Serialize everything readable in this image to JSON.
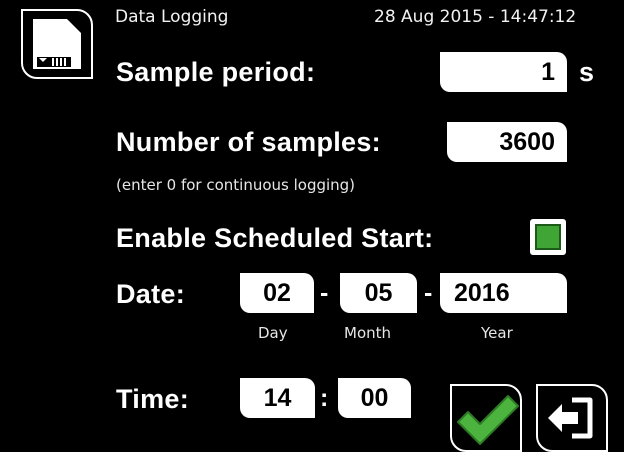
{
  "header": {
    "title": "Data Logging",
    "datetime": "28 Aug 2015 - 14:47:12"
  },
  "sample_period": {
    "label": "Sample period:",
    "value": "1",
    "unit": "s"
  },
  "number_of_samples": {
    "label": "Number of samples:",
    "value": "3600",
    "hint": "(enter 0 for continuous logging)"
  },
  "scheduled_start": {
    "label": "Enable Scheduled Start:",
    "checked": true
  },
  "date": {
    "label": "Date:",
    "day": "02",
    "month": "05",
    "year": "2016",
    "separator": "-",
    "day_caption": "Day",
    "month_caption": "Month",
    "year_caption": "Year"
  },
  "time": {
    "label": "Time:",
    "hour": "14",
    "minute": "00",
    "separator": ":"
  },
  "icons": {
    "storage": "sd-card-icon",
    "confirm": "checkmark-icon",
    "exit": "exit-arrow-icon"
  },
  "colors": {
    "background": "#000000",
    "field": "#ffffff",
    "accent_green": "#3fa535"
  }
}
